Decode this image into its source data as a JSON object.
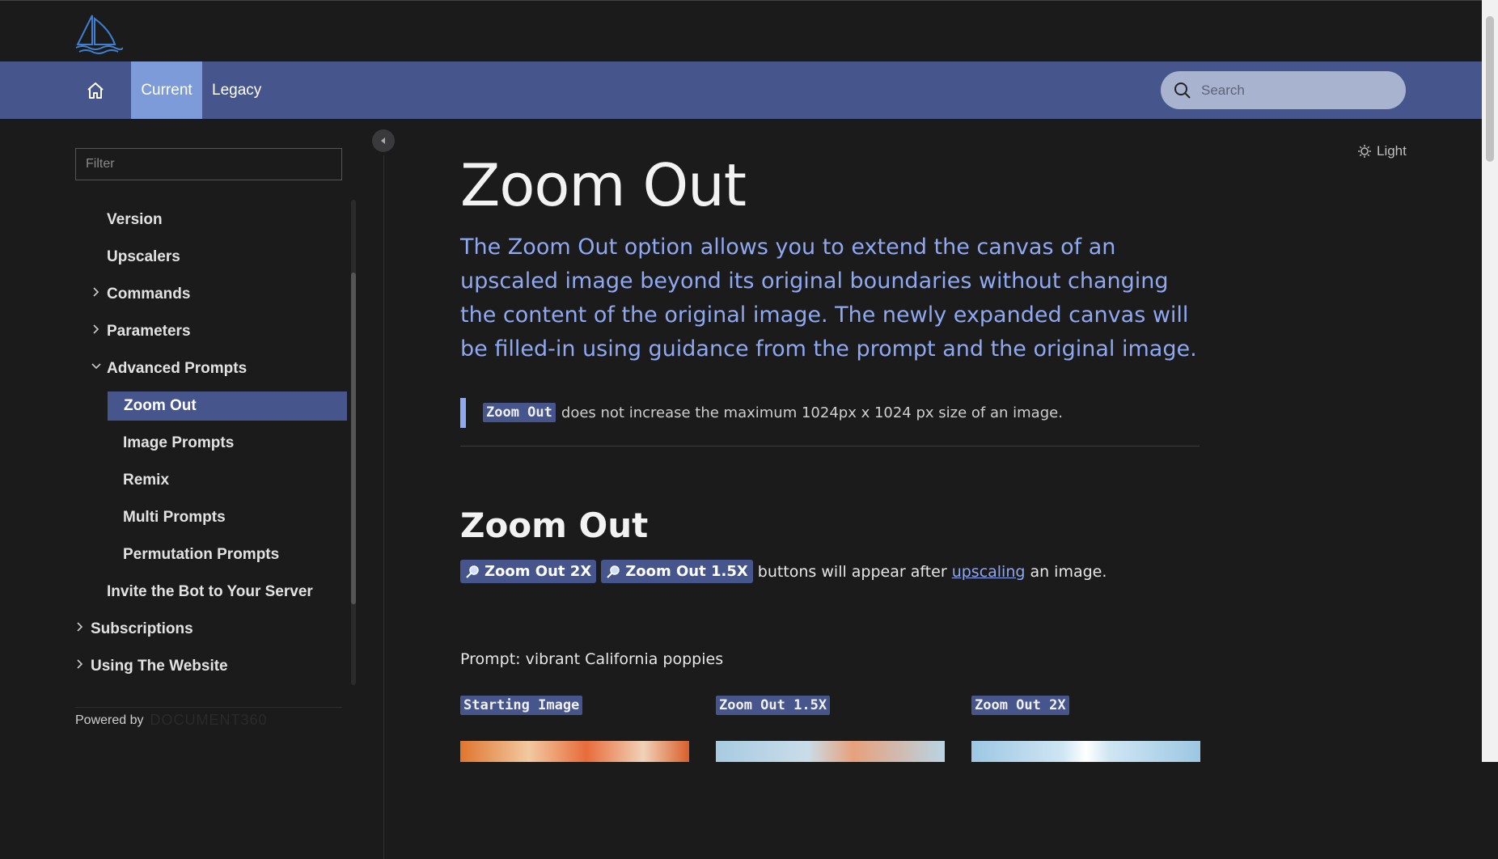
{
  "nav": {
    "tabs": [
      {
        "label": "Current"
      },
      {
        "label": "Legacy"
      }
    ],
    "search_placeholder": "Search"
  },
  "sidebar": {
    "filter_placeholder": "Filter",
    "items": [
      {
        "label": "Version"
      },
      {
        "label": "Upscalers"
      },
      {
        "label": "Commands"
      },
      {
        "label": "Parameters"
      },
      {
        "label": "Advanced Prompts"
      },
      {
        "label": "Zoom Out"
      },
      {
        "label": "Image Prompts"
      },
      {
        "label": "Remix"
      },
      {
        "label": "Multi Prompts"
      },
      {
        "label": "Permutation Prompts"
      },
      {
        "label": "Invite the Bot to Your Server"
      },
      {
        "label": "Subscriptions"
      },
      {
        "label": "Using The Website"
      }
    ],
    "powered_by": "Powered by",
    "powered_brand": "DOCUMENT360"
  },
  "main": {
    "theme_label": "Light",
    "title": "Zoom Out",
    "lead": "The Zoom Out option allows you to extend the canvas of an upscaled image beyond its original boundaries without changing the content of the original image. The newly expanded canvas will be filled-in using guidance from the prompt and the original image.",
    "note_code": "Zoom Out",
    "note_text": "does not increase the maximum 1024px x 1024 px size of an image.",
    "section_title": "Zoom Out",
    "btn_2x": "Zoom Out 2X",
    "btn_15x": "Zoom Out 1.5X",
    "zoom_text_a": "buttons will appear after",
    "zoom_link": "upscaling",
    "zoom_text_b": "an image.",
    "prompt": "Prompt: vibrant California poppies",
    "image_labels": [
      "Starting Image",
      "Zoom Out 1.5X",
      "Zoom Out 2X"
    ]
  },
  "colors": {
    "accent": "#46568d",
    "accent_light": "#7d9bd8",
    "lead_text": "#8ea8f2",
    "background": "#1b1b1c"
  }
}
